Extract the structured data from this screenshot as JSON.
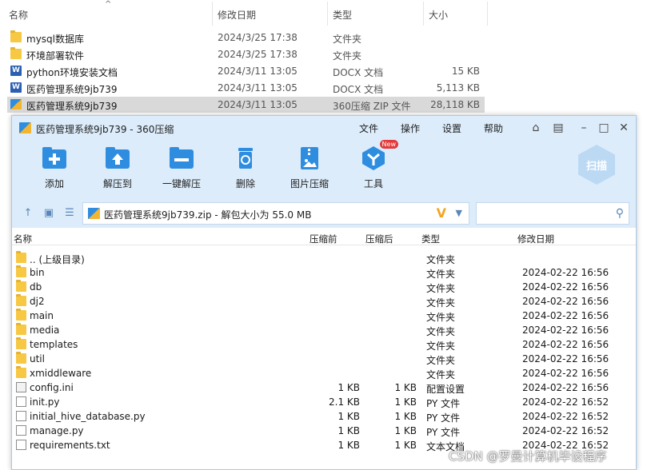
{
  "explorer": {
    "sort_arrow": "^",
    "columns": {
      "name": "名称",
      "date": "修改日期",
      "type": "类型",
      "size": "大小"
    },
    "rows": [
      {
        "icon": "folder-icon",
        "name": "mysql数据库",
        "date": "2024/3/25 17:38",
        "type": "文件夹",
        "size": ""
      },
      {
        "icon": "folder-icon",
        "name": "环境部署软件",
        "date": "2024/3/25 17:38",
        "type": "文件夹",
        "size": ""
      },
      {
        "icon": "word-doc-icon",
        "name": "python环境安装文档",
        "date": "2024/3/11 13:05",
        "type": "DOCX 文档",
        "size": "15 KB"
      },
      {
        "icon": "word-doc-icon",
        "name": "医药管理系统9jb739",
        "date": "2024/3/11 13:05",
        "type": "DOCX 文档",
        "size": "5,113 KB"
      },
      {
        "icon": "zip-archive-icon",
        "name": "医药管理系统9jb739",
        "date": "2024/3/11 13:05",
        "type": "360压缩 ZIP 文件",
        "size": "28,118 KB",
        "selected": true
      }
    ]
  },
  "window": {
    "title": "医药管理系统9jb739 - 360压缩",
    "menu": [
      "文件",
      "操作",
      "设置",
      "帮助"
    ],
    "toolbar": [
      {
        "icon": "add-icon",
        "label": "添加"
      },
      {
        "icon": "extract-to-icon",
        "label": "解压到"
      },
      {
        "icon": "one-click-extract-icon",
        "label": "一键解压"
      },
      {
        "icon": "delete-icon",
        "label": "删除"
      },
      {
        "icon": "image-compress-icon",
        "label": "图片压缩"
      },
      {
        "icon": "tools-icon",
        "label": "工具",
        "badge": "New"
      }
    ],
    "scan_label": "扫描",
    "address": "医药管理系统9jb739.zip - 解包大小为 55.0 MB",
    "search_placeholder": "",
    "columns": {
      "name": "名称",
      "compressed": "压缩前",
      "original": "压缩后",
      "type": "类型",
      "date": "修改日期"
    },
    "files": [
      {
        "icon": "folder-icon",
        "name": ".. (上级目录)",
        "compressed": "",
        "original": "",
        "type": "文件夹",
        "date": ""
      },
      {
        "icon": "folder-icon",
        "name": "bin",
        "compressed": "",
        "original": "",
        "type": "文件夹",
        "date": "2024-02-22 16:56"
      },
      {
        "icon": "folder-icon",
        "name": "db",
        "compressed": "",
        "original": "",
        "type": "文件夹",
        "date": "2024-02-22 16:56"
      },
      {
        "icon": "folder-icon",
        "name": "dj2",
        "compressed": "",
        "original": "",
        "type": "文件夹",
        "date": "2024-02-22 16:56"
      },
      {
        "icon": "folder-icon",
        "name": "main",
        "compressed": "",
        "original": "",
        "type": "文件夹",
        "date": "2024-02-22 16:56"
      },
      {
        "icon": "folder-icon",
        "name": "media",
        "compressed": "",
        "original": "",
        "type": "文件夹",
        "date": "2024-02-22 16:56"
      },
      {
        "icon": "folder-icon",
        "name": "templates",
        "compressed": "",
        "original": "",
        "type": "文件夹",
        "date": "2024-02-22 16:56"
      },
      {
        "icon": "folder-icon",
        "name": "util",
        "compressed": "",
        "original": "",
        "type": "文件夹",
        "date": "2024-02-22 16:56"
      },
      {
        "icon": "folder-icon",
        "name": "xmiddleware",
        "compressed": "",
        "original": "",
        "type": "文件夹",
        "date": "2024-02-22 16:56"
      },
      {
        "icon": "config-file-icon",
        "name": "config.ini",
        "compressed": "1 KB",
        "original": "1 KB",
        "type": "配置设置",
        "date": "2024-02-22 16:56"
      },
      {
        "icon": "file-icon",
        "name": "init.py",
        "compressed": "2.1 KB",
        "original": "1 KB",
        "type": "PY 文件",
        "date": "2024-02-22 16:52"
      },
      {
        "icon": "file-icon",
        "name": "initial_hive_database.py",
        "compressed": "1 KB",
        "original": "1 KB",
        "type": "PY 文件",
        "date": "2024-02-22 16:52"
      },
      {
        "icon": "file-icon",
        "name": "manage.py",
        "compressed": "1 KB",
        "original": "1 KB",
        "type": "PY 文件",
        "date": "2024-02-22 16:52"
      },
      {
        "icon": "file-icon",
        "name": "requirements.txt",
        "compressed": "1 KB",
        "original": "1 KB",
        "type": "文本文档",
        "date": "2024-02-22 16:52"
      }
    ]
  },
  "watermark": "CSDN @罗曼计算机毕设程序",
  "colors": {
    "chrome_bg": "#dcecfb",
    "accent": "#2f8de0",
    "folder": "#f7c843",
    "selected_row": "#d9d9d9"
  }
}
